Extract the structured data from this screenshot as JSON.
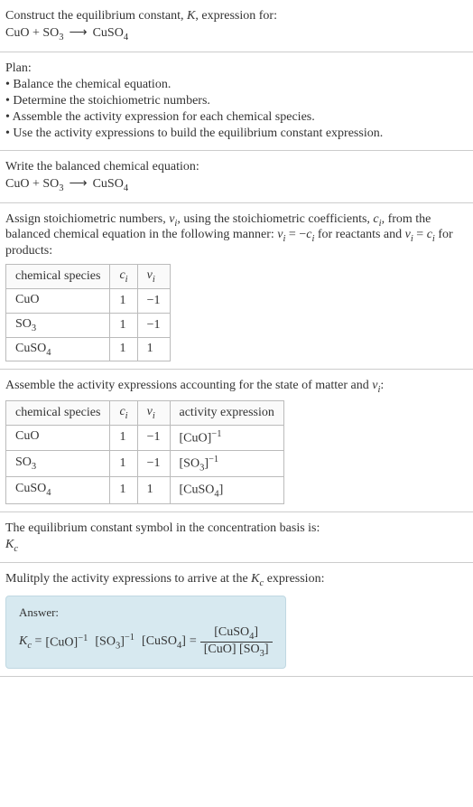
{
  "prompt": {
    "line1_a": "Construct the equilibrium constant, ",
    "line1_K": "K",
    "line1_b": ", expression for:",
    "eq_lhs1": "CuO",
    "eq_plus": " + ",
    "eq_lhs2": "SO",
    "eq_lhs2_sub": "3",
    "eq_arrow": "⟶",
    "eq_rhs": "CuSO",
    "eq_rhs_sub": "4"
  },
  "plan": {
    "heading": "Plan:",
    "b1": "• Balance the chemical equation.",
    "b2": "• Determine the stoichiometric numbers.",
    "b3": "• Assemble the activity expression for each chemical species.",
    "b4": "• Use the activity expressions to build the equilibrium constant expression."
  },
  "balanced": {
    "heading": "Write the balanced chemical equation:"
  },
  "stoich": {
    "text_a": "Assign stoichiometric numbers, ",
    "nu": "ν",
    "nu_sub": "i",
    "text_b": ", using the stoichiometric coefficients, ",
    "c": "c",
    "c_sub": "i",
    "text_c": ", from the balanced chemical equation in the following manner: ",
    "rel1_a": "ν",
    "rel1_b": " = −",
    "rel1_c": "c",
    "text_d": " for reactants and ",
    "rel2_a": "ν",
    "rel2_b": " = ",
    "rel2_c": "c",
    "text_e": " for products:",
    "headers": {
      "h1": "chemical species",
      "h2": "c",
      "h2_sub": "i",
      "h3": "ν",
      "h3_sub": "i"
    },
    "rows": [
      {
        "sp": "CuO",
        "sp_sub": "",
        "c": "1",
        "nu": "−1"
      },
      {
        "sp": "SO",
        "sp_sub": "3",
        "c": "1",
        "nu": "−1"
      },
      {
        "sp": "CuSO",
        "sp_sub": "4",
        "c": "1",
        "nu": "1"
      }
    ]
  },
  "activity": {
    "text_a": "Assemble the activity expressions accounting for the state of matter and ",
    "nu": "ν",
    "nu_sub": "i",
    "text_b": ":",
    "headers": {
      "h1": "chemical species",
      "h2": "c",
      "h2_sub": "i",
      "h3": "ν",
      "h3_sub": "i",
      "h4": "activity expression"
    },
    "rows": [
      {
        "sp": "CuO",
        "sp_sub": "",
        "c": "1",
        "nu": "−1",
        "act": "[CuO]",
        "act_sup": "−1"
      },
      {
        "sp": "SO",
        "sp_sub": "3",
        "c": "1",
        "nu": "−1",
        "act": "[SO",
        "act_sub": "3",
        "act_close": "]",
        "act_sup": "−1"
      },
      {
        "sp": "CuSO",
        "sp_sub": "4",
        "c": "1",
        "nu": "1",
        "act": "[CuSO",
        "act_sub": "4",
        "act_close": "]",
        "act_sup": ""
      }
    ]
  },
  "symbol": {
    "text": "The equilibrium constant symbol in the concentration basis is:",
    "K": "K",
    "K_sub": "c"
  },
  "mult": {
    "text_a": "Mulitply the activity expressions to arrive at the ",
    "K": "K",
    "K_sub": "c",
    "text_b": " expression:"
  },
  "answer": {
    "label": "Answer:",
    "K": "K",
    "K_sub": "c",
    "eq": " = ",
    "t1": "[CuO]",
    "t1_sup": "−1",
    "sp": " ",
    "t2": "[SO",
    "t2_sub": "3",
    "t2_close": "]",
    "t2_sup": "−1",
    "t3": "[CuSO",
    "t3_sub": "4",
    "t3_close": "]",
    "eq2": " = ",
    "num": "[CuSO",
    "num_sub": "4",
    "num_close": "]",
    "den_a": "[CuO] [SO",
    "den_a_sub": "3",
    "den_a_close": "]"
  }
}
